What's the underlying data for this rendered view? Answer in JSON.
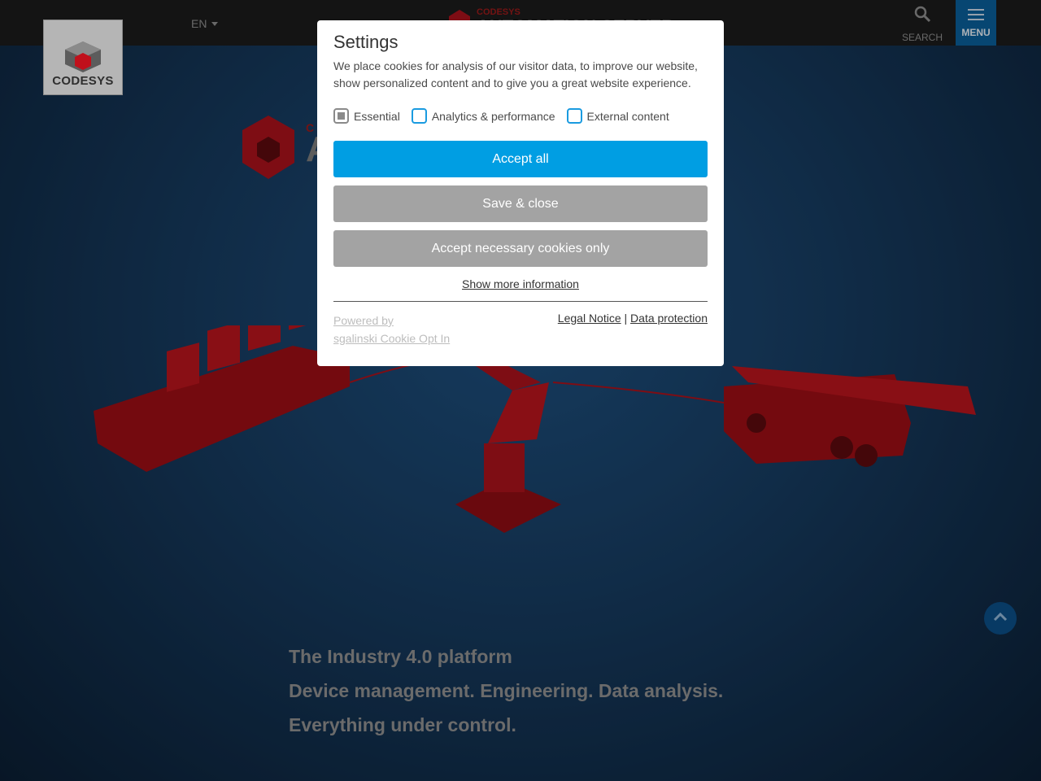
{
  "header": {
    "logo_text": "CODESYS",
    "language": "EN",
    "brand_small": "CODESYS",
    "brand_big": "AUTOMATION SERVER",
    "search_label": "SEARCH",
    "menu_label": "MENU"
  },
  "hero": {
    "line1": "The Industry 4.0 platform",
    "line2": "Device management. Engineering. Data analysis.",
    "line3": "Everything under control."
  },
  "modal": {
    "title": "Settings",
    "description": "We place cookies for analysis of our visitor data, to improve our website, show personalized content and to give you a great website experience.",
    "checkboxes": [
      {
        "label": "Essential",
        "checked": true,
        "disabled": true
      },
      {
        "label": "Analytics & performance",
        "checked": false
      },
      {
        "label": "External content",
        "checked": false
      }
    ],
    "accept_all": "Accept all",
    "save_close": "Save & close",
    "accept_necessary": "Accept necessary cookies only",
    "show_more": "Show more information",
    "powered_by": "Powered by",
    "powered_name": "sgalinski Cookie Opt In",
    "legal_notice": "Legal Notice",
    "separator": "|",
    "data_protection": "Data protection"
  },
  "colors": {
    "accent": "#009ee3",
    "brand_red": "#b0101a",
    "menu_bg": "#0a5e99"
  },
  "icons": [
    "search-icon",
    "menu-icon",
    "chevron-up-icon"
  ]
}
